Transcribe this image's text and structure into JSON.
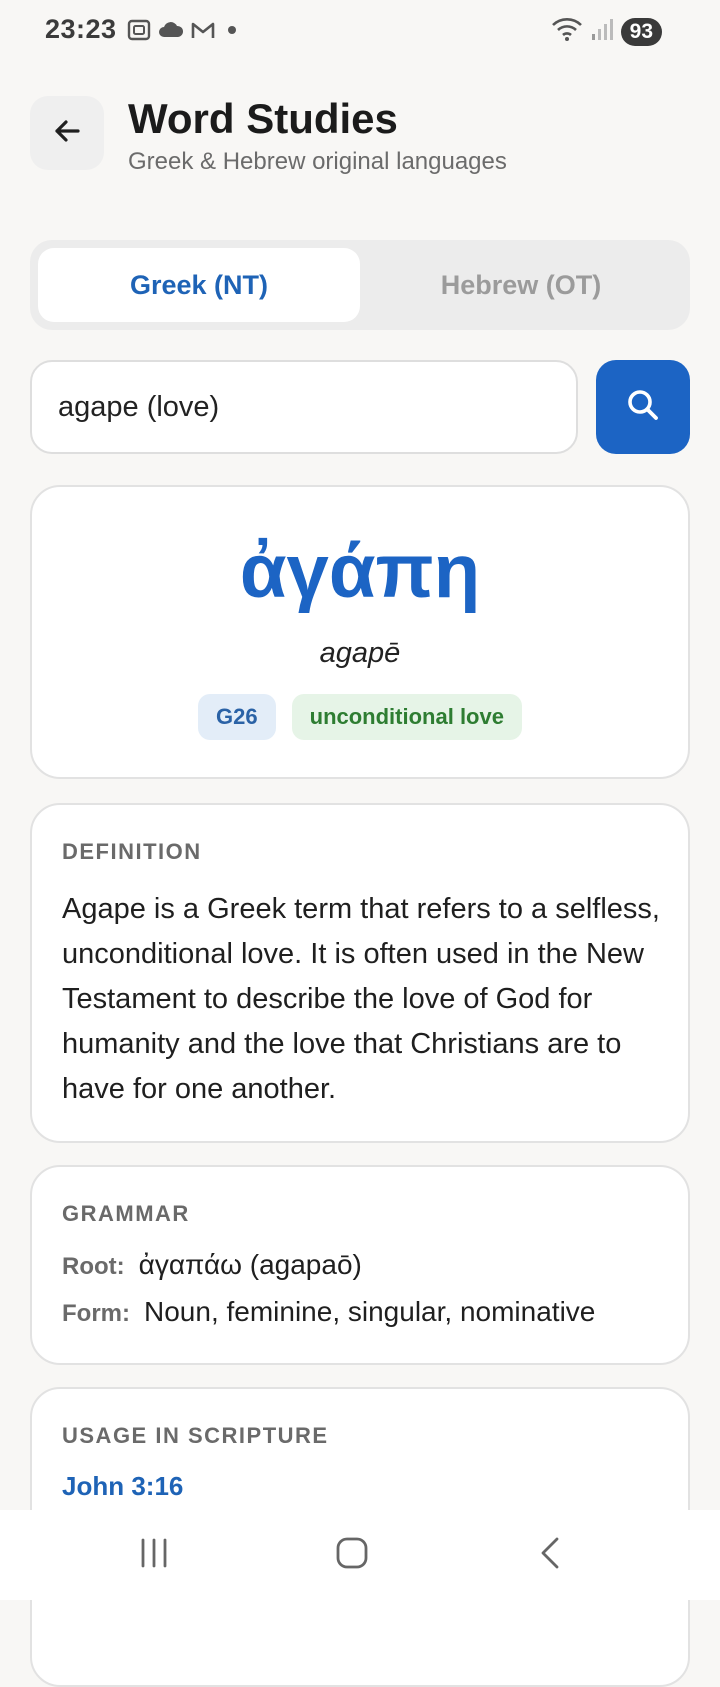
{
  "status": {
    "time": "23:23",
    "battery": "93",
    "left_icons": [
      "screenshot-icon",
      "cloud-icon",
      "gmail-icon",
      "dot-icon"
    ],
    "right_icons": [
      "wifi-icon",
      "signal-icon"
    ]
  },
  "header": {
    "title": "Word Studies",
    "subtitle": "Greek & Hebrew original languages",
    "back_icon": "arrow-left-icon"
  },
  "tabs": [
    {
      "label": "Greek (NT)",
      "active": true
    },
    {
      "label": "Hebrew (OT)",
      "active": false
    }
  ],
  "search": {
    "value": "agape (love)",
    "button_icon": "search-icon"
  },
  "word": {
    "original": "ἀγάπη",
    "transliteration": "agapē",
    "strongs": "G26",
    "gloss": "unconditional love"
  },
  "definition": {
    "label": "DEFINITION",
    "text": "Agape is a Greek term that refers to a selfless, unconditional love. It is often used in the New Testament to describe the love of God for humanity and the love that Christians are to have for one another."
  },
  "grammar": {
    "label": "GRAMMAR",
    "root_key": "Root:",
    "root_value": "ἀγαπάω (agapaō)",
    "form_key": "Form:",
    "form_value": "Noun, feminine, singular, nominative"
  },
  "usage": {
    "label": "USAGE IN SCRIPTURE",
    "references": [
      "John 3:16"
    ]
  },
  "colors": {
    "accent": "#1c64c4",
    "gloss_green": "#2e7d32",
    "background": "#f8f7f5"
  },
  "navbar": {
    "icons": [
      "recent-apps-icon",
      "home-icon",
      "back-icon"
    ]
  }
}
